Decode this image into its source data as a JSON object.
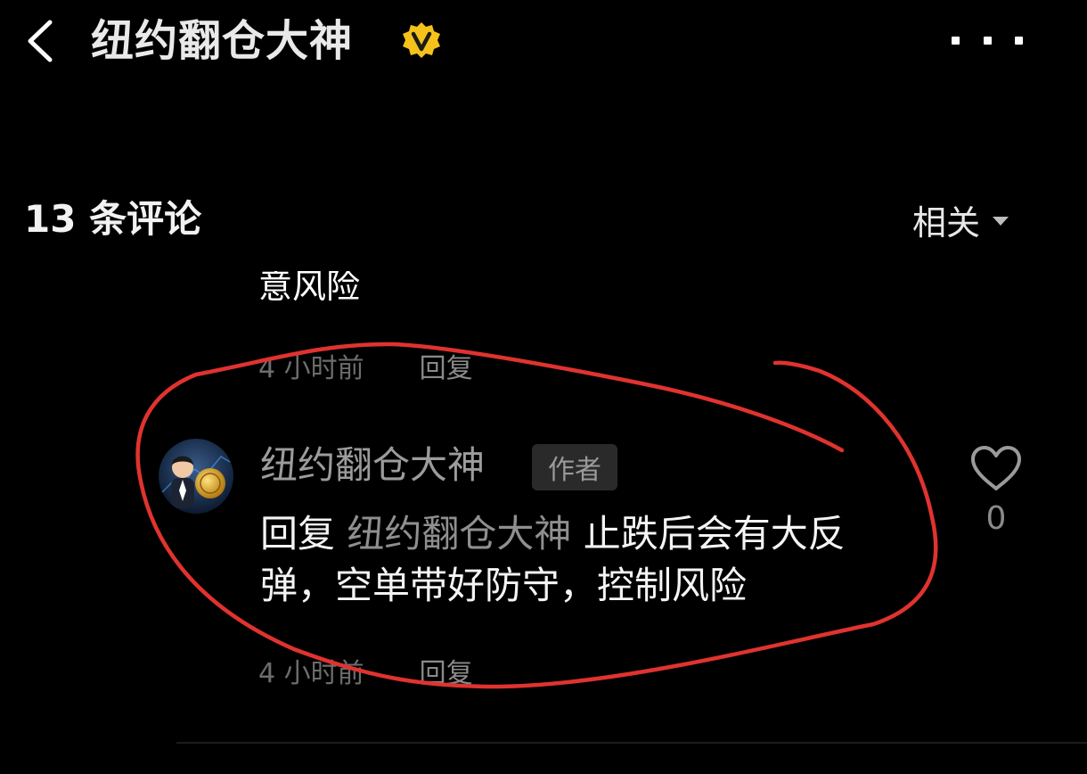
{
  "header": {
    "title": "纽约翻仓大神",
    "back_icon": "chevron-left-icon",
    "verified_icon": "verified-v-badge-icon",
    "more_icon": "more-dots-icon"
  },
  "comments_header": {
    "count_label": "13 条评论",
    "sort_label": "相关",
    "sort_icon": "caret-down-icon"
  },
  "previous_comment": {
    "text_partial": "意风险",
    "time": "4 小时前",
    "reply_label": "回复"
  },
  "author_comment": {
    "author": "纽约翻仓大神",
    "author_tag": "作者",
    "reply_prefix": "回复",
    "mention": "纽约翻仓大神",
    "text_line1": "止跌后会有大反",
    "text_line2": "弹，空单带好防守，控制风险",
    "time": "4 小时前",
    "reply_label": "回复",
    "like_count": "0",
    "like_icon": "heart-outline-icon"
  },
  "colors": {
    "background": "#000000",
    "badge_gold": "#f5c21b",
    "annotation_red": "#e0332f",
    "muted_text": "#9c9c9c"
  }
}
